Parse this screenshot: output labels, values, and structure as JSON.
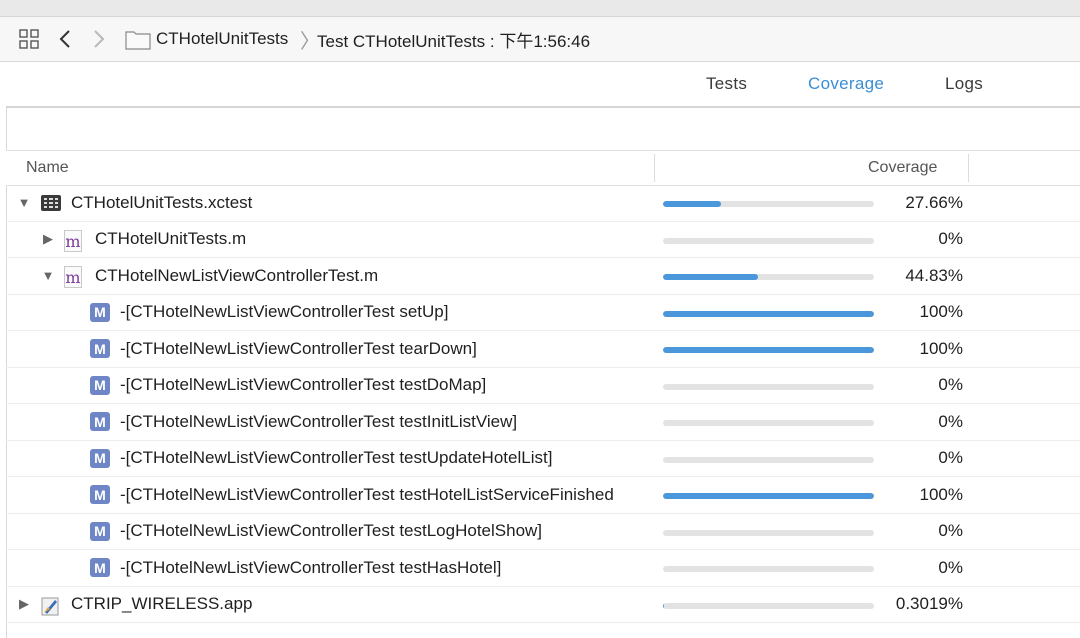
{
  "toolbar": {
    "crumb1": "CTHotelUnitTests",
    "separator": "〉",
    "crumb2": "Test CTHotelUnitTests : 下午1:56:46"
  },
  "tabs": [
    {
      "label": "Tests"
    },
    {
      "label": "Coverage"
    },
    {
      "label": "Logs"
    }
  ],
  "columns": {
    "name": "Name",
    "coverage": "Coverage"
  },
  "colors": {
    "accent": "#3b8ed6",
    "bar": "#4a97dc",
    "track": "#e3e3e3"
  },
  "rows": [
    {
      "label": "CTHotelUnitTests.xctest",
      "pct": "27.66%",
      "fill": 0.2766,
      "icon": "xctest-bundle-icon",
      "level": 0,
      "expanded": true
    },
    {
      "label": "CTHotelUnitTests.m",
      "pct": "0%",
      "fill": 0,
      "icon": "m-file-icon",
      "level": 1,
      "expanded": false
    },
    {
      "label": "CTHotelNewListViewControllerTest.m",
      "pct": "44.83%",
      "fill": 0.4483,
      "icon": "m-file-icon",
      "level": 1,
      "expanded": true
    },
    {
      "label": "-[CTHotelNewListViewControllerTest setUp]",
      "pct": "100%",
      "fill": 1.0,
      "icon": "method-icon",
      "level": 2
    },
    {
      "label": "-[CTHotelNewListViewControllerTest tearDown]",
      "pct": "100%",
      "fill": 1.0,
      "icon": "method-icon",
      "level": 2
    },
    {
      "label": "-[CTHotelNewListViewControllerTest testDoMap]",
      "pct": "0%",
      "fill": 0,
      "icon": "method-icon",
      "level": 2
    },
    {
      "label": "-[CTHotelNewListViewControllerTest testInitListView]",
      "pct": "0%",
      "fill": 0,
      "icon": "method-icon",
      "level": 2
    },
    {
      "label": "-[CTHotelNewListViewControllerTest testUpdateHotelList]",
      "pct": "0%",
      "fill": 0,
      "icon": "method-icon",
      "level": 2
    },
    {
      "label": "-[CTHotelNewListViewControllerTest testHotelListServiceFinished",
      "pct": "100%",
      "fill": 1.0,
      "icon": "method-icon",
      "level": 2
    },
    {
      "label": "-[CTHotelNewListViewControllerTest testLogHotelShow]",
      "pct": "0%",
      "fill": 0,
      "icon": "method-icon",
      "level": 2
    },
    {
      "label": "-[CTHotelNewListViewControllerTest testHasHotel]",
      "pct": "0%",
      "fill": 0,
      "icon": "method-icon",
      "level": 2
    },
    {
      "label": "CTRIP_WIRELESS.app",
      "pct": "0.3019%",
      "fill": 0.003019,
      "icon": "app-icon",
      "level": 0,
      "expanded": false
    }
  ]
}
